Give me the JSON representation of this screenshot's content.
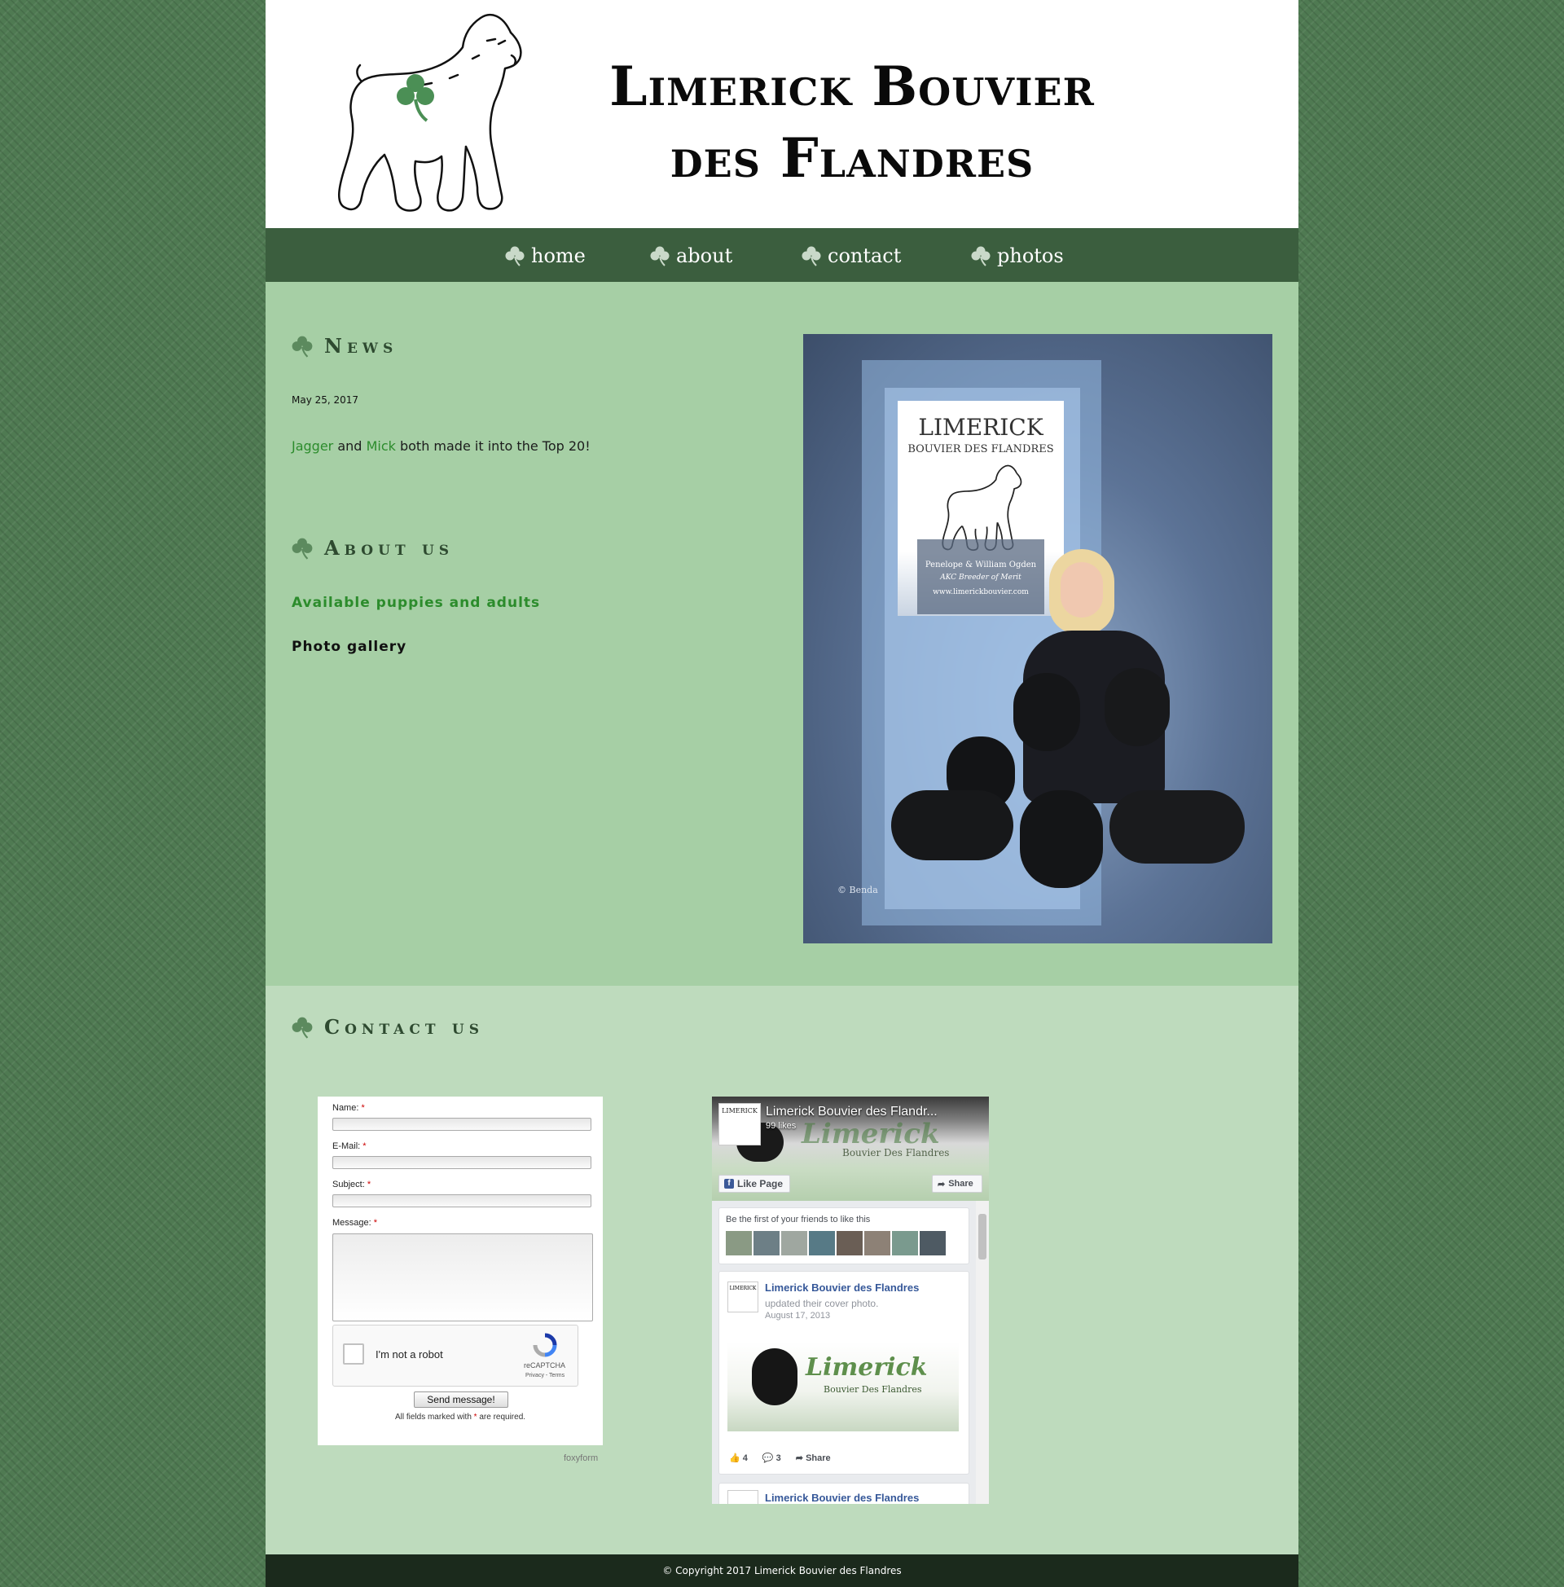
{
  "site": {
    "title": "Limerick Bouvier des Flandres"
  },
  "nav": {
    "items": [
      "home",
      "about",
      "contact",
      "photos"
    ]
  },
  "news": {
    "heading": "News",
    "date": "May 25, 2017",
    "link1": "Jagger",
    "and": "and",
    "link2": "Mick",
    "rest": "both made it into the Top 20!"
  },
  "about": {
    "heading": "About us",
    "link_available": "Available puppies and adults",
    "link_gallery": "Photo gallery"
  },
  "poster": {
    "title": "LIMERICK",
    "subtitle": "BOUVIER DES FLANDRES",
    "names": "Penelope & William Ogden",
    "award": "AKC Breeder of Merit",
    "url": "www.limerickbouvier.com",
    "credit": "© Benda"
  },
  "contact": {
    "heading": "Contact us",
    "form": {
      "name_label": "Name:",
      "email_label": "E-Mail:",
      "subject_label": "Subject:",
      "message_label": "Message:",
      "req_mark": "*",
      "captcha_text": "I'm not a robot",
      "captcha_brand": "reCAPTCHA",
      "captcha_links": "Privacy - Terms",
      "send_label": "Send message!",
      "note_before": "All fields marked with",
      "note_after": "are required.",
      "foxy": "foxyform"
    },
    "facebook": {
      "page_name": "Limerick Bouvier des Flandr...",
      "likes": "99 likes",
      "like_btn": "Like Page",
      "share_btn": "Share",
      "logo_text": "LIMERICK",
      "friends_text": "Be the first of your friends to like this",
      "post_author": "Limerick Bouvier des Flandres",
      "post_action": "updated their cover photo.",
      "post_date": "August 17, 2013",
      "cover_word": "Limerick",
      "cover_sub": "Bouvier Des Flandres",
      "post_likes": "4",
      "post_comments": "3",
      "post_share": "Share",
      "next_author": "Limerick Bouvier des Flandres"
    }
  },
  "footer": {
    "copyright": "© Copyright 2017 Limerick Bouvier des Flandres"
  },
  "colors": {
    "nav_bg": "#3b5e3e",
    "main_bg": "#a6cfa5",
    "contact_bg": "#bedbbd",
    "link_green": "#2c8c2c",
    "footer_bg": "#1b2a1c"
  },
  "icons": {
    "shamrock": "shamrock-icon",
    "dog_logo": "dog-logo-icon"
  }
}
